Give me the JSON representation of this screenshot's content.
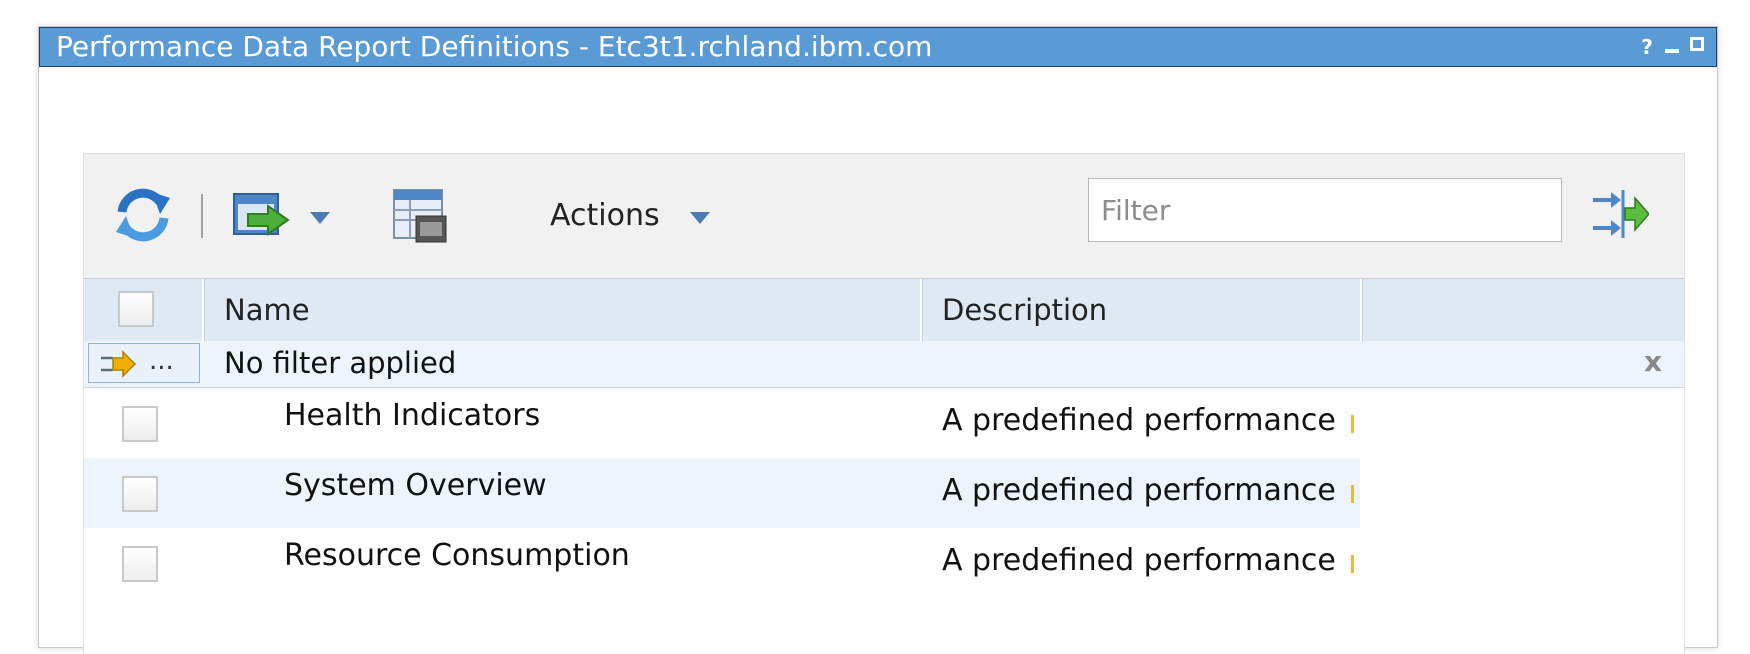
{
  "window": {
    "title": "Performance Data Report Definitions - Etc3t1.rchland.ibm.com",
    "help_label": "?"
  },
  "toolbar": {
    "actions_label": "Actions",
    "filter_placeholder": "Filter"
  },
  "columns": [
    "Name",
    "Description"
  ],
  "filter_row": {
    "button_label": "...",
    "status_text": "No filter applied",
    "clear_label": "x"
  },
  "rows": [
    {
      "name": "Health Indicators",
      "description": "A predefined performance"
    },
    {
      "name": "System Overview",
      "description": "A predefined performance"
    },
    {
      "name": "Resource Consumption",
      "description": "A predefined performance"
    }
  ],
  "colors": {
    "titlebar": "#5b9bd5",
    "header": "#dfe9f3",
    "row_alt": "#eef4fb"
  }
}
